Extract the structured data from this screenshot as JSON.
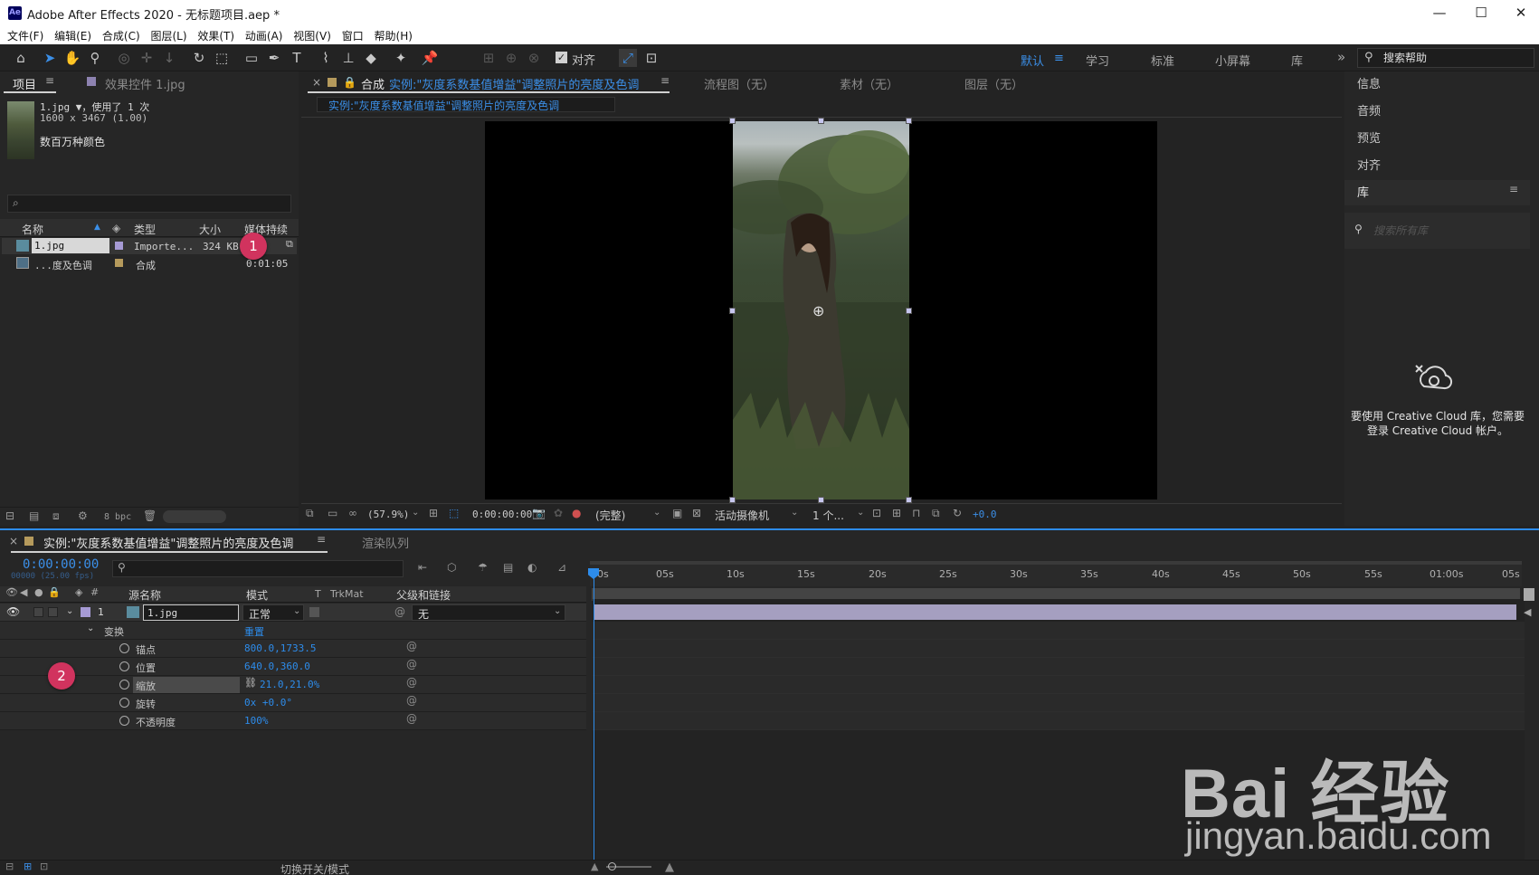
{
  "titlebar": {
    "icon": "Ae",
    "title": "Adobe After Effects 2020 - 无标题项目.aep *",
    "minimize": "—",
    "maximize": "☐",
    "close": "✕"
  },
  "menu": [
    "文件(F)",
    "编辑(E)",
    "合成(C)",
    "图层(L)",
    "效果(T)",
    "动画(A)",
    "视图(V)",
    "窗口",
    "帮助(H)"
  ],
  "toolbar": {
    "snap_label": "对齐",
    "workspaces": [
      "默认",
      "学习",
      "标准",
      "小屏幕",
      "库"
    ],
    "workspace_active": "默认",
    "more": "»",
    "help_search": "搜索帮助"
  },
  "project": {
    "tab": "项目",
    "effects_tab": "效果控件 1.jpg",
    "item_name": "1.jpg ▼，使用了 1 次",
    "item_dims": "1600 x 3467 (1.00)",
    "item_color": "数百万种颜色",
    "search_icon": "⌕",
    "columns": [
      "名称",
      "类型",
      "大小",
      "媒体持续"
    ],
    "rows": [
      {
        "name": "1.jpg",
        "type": "Importe...",
        "size": "324 KB",
        "duration": ""
      },
      {
        "name": "...度及色调",
        "type": "合成",
        "size": "",
        "duration": "0:01:05"
      }
    ],
    "bpc": "8 bpc"
  },
  "comp": {
    "close": "×",
    "tab_prefix": "合成",
    "tab_name": "实例:\"灰度系数基值增益\"调整照片的亮度及色调",
    "flow": "流程图（无）",
    "footage": "素材（无）",
    "layer": "图层（无）",
    "subtab": "实例:\"灰度系数基值增益\"调整照片的亮度及色调",
    "zoom": "(57.9%)",
    "timecode": "0:00:00:00",
    "quality": "(完整)",
    "camera": "活动摄像机",
    "views": "1 个...",
    "exposure": "+0.0"
  },
  "right_panels": {
    "items": [
      "信息",
      "音频",
      "预览",
      "对齐"
    ],
    "library": "库",
    "library_search": "搜索所有库",
    "cc_message": "要使用 Creative Cloud 库，您需要登录 Creative Cloud 帐户。"
  },
  "timeline": {
    "tab": "实例:\"灰度系数基值增益\"调整照片的亮度及色调",
    "render_queue": "渲染队列",
    "timecode": "0:00:00:00",
    "frame_info": "00000 (25.00 fps)",
    "headers": {
      "source_name": "源名称",
      "mode": "模式",
      "t": "T",
      "trkmat": "TrkMat",
      "parent": "父级和链接"
    },
    "layer": {
      "num": "1",
      "name": "1.jpg",
      "mode": "正常",
      "parent": "无"
    },
    "transform": {
      "label": "变换",
      "reset": "重置"
    },
    "properties": [
      {
        "name": "锚点",
        "value": "800.0,1733.5"
      },
      {
        "name": "位置",
        "value": "640.0,360.0"
      },
      {
        "name": "缩放",
        "value": "21.0,21.0%"
      },
      {
        "name": "旋转",
        "value": "0x +0.0°"
      },
      {
        "name": "不透明度",
        "value": "100%"
      }
    ],
    "ruler": [
      "0s",
      "05s",
      "10s",
      "15s",
      "20s",
      "25s",
      "30s",
      "35s",
      "40s",
      "45s",
      "50s",
      "55s",
      "01:00s",
      "05s"
    ],
    "footer": "切换开关/模式"
  },
  "badges": [
    "1",
    "2"
  ],
  "watermark": {
    "main": "Bai 经验",
    "url": "jingyan.baidu.com"
  }
}
